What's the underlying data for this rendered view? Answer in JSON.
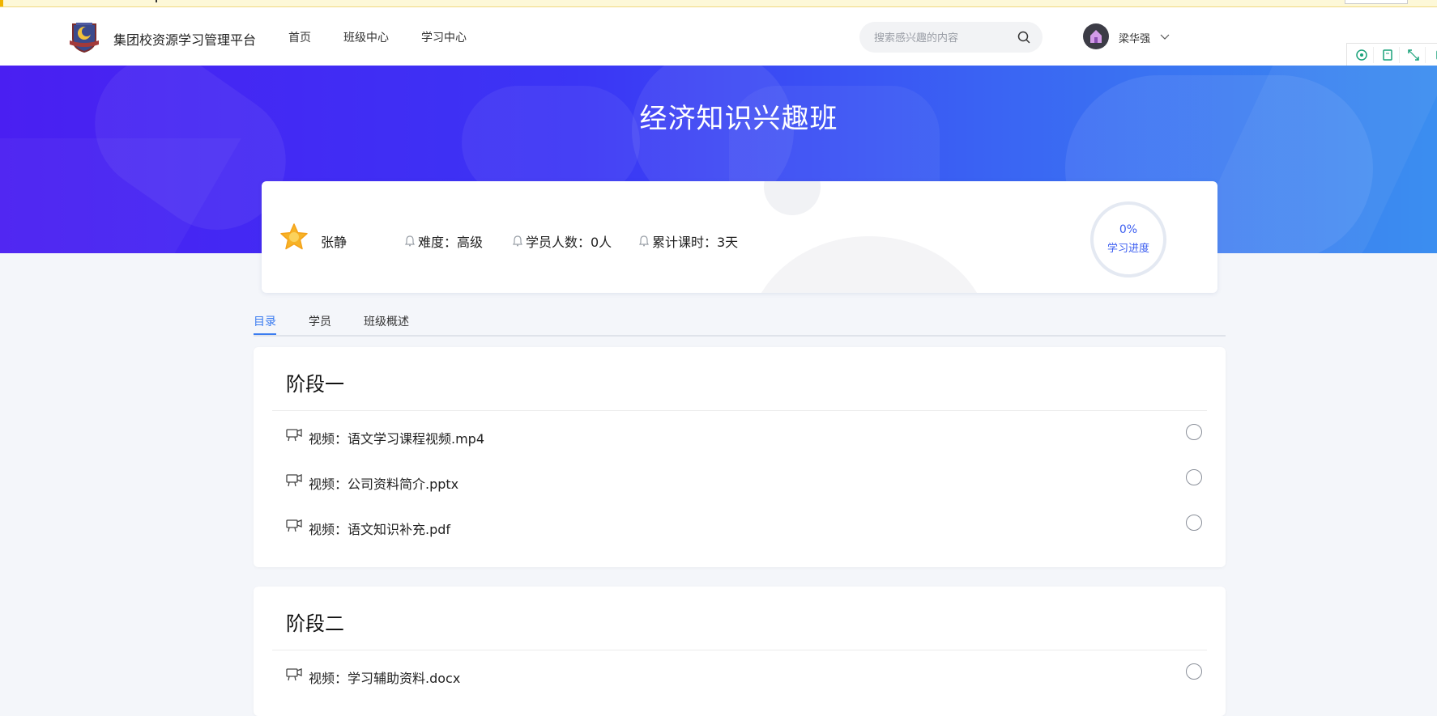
{
  "header": {
    "brand": "集团校资源学习管理平台",
    "nav": [
      "首页",
      "班级中心",
      "学习中心"
    ],
    "search_placeholder": "搜索感兴趣的内容",
    "user_name": "梁华强"
  },
  "banner": {
    "title": "经济知识兴趣班"
  },
  "class_info": {
    "teacher": "张静",
    "difficulty": "难度：高级",
    "students": "学员人数：0人",
    "duration": "累计课时：3天",
    "progress_value": "0%",
    "progress_label": "学习进度",
    "progress_fraction": 0
  },
  "tabs": [
    {
      "label": "目录",
      "active": true
    },
    {
      "label": "学员",
      "active": false
    },
    {
      "label": "班级概述",
      "active": false
    }
  ],
  "sections": [
    {
      "title": "阶段一",
      "items": [
        "视频：语文学习课程视频.mp4",
        "视频：公司资料简介.pptx",
        "视频：语文知识补充.pdf"
      ]
    },
    {
      "title": "阶段二",
      "items": [
        "视频：学习辅助资料.docx"
      ]
    }
  ],
  "colors": {
    "accent": "#3b7cf0",
    "banner_start": "#4a1ff2",
    "banner_end": "#3b8ef0",
    "page_bg": "#f4f6fa"
  },
  "icons": [
    "search-icon",
    "chevron-down-icon",
    "star-badge-icon",
    "bell-icon",
    "video-icon",
    "tool-icons"
  ]
}
